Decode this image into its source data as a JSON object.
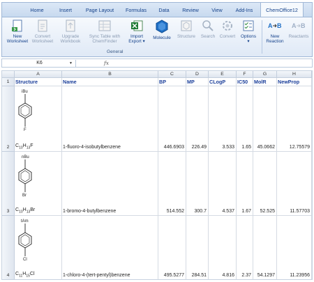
{
  "ribbon_tabs": [
    "Home",
    "Insert",
    "Page Layout",
    "Formulas",
    "Data",
    "Review",
    "View",
    "Add-Ins",
    "ChemOffice12"
  ],
  "active_tab": "ChemOffice12",
  "ribbon": {
    "new_worksheet": [
      "New",
      "Worksheet"
    ],
    "convert_worksheet": [
      "Convert",
      "Worksheet"
    ],
    "upgrade_workbook": [
      "Upgrade",
      "Workbook"
    ],
    "sync_table": [
      "Sync Table with",
      "ChemFinder"
    ],
    "import_export": [
      "Import",
      "Export ▾"
    ],
    "molecule": "Molecule",
    "structure": "Structure",
    "search": "Search",
    "convert": "Convert",
    "options": "Options",
    "new_reaction": [
      "New",
      "Reaction"
    ],
    "reactants": "Reactants",
    "group_label": "General"
  },
  "formula_bar": {
    "name_box": "K6",
    "fx": "fx",
    "formula": ""
  },
  "columns": [
    "A",
    "B",
    "C",
    "D",
    "E",
    "F",
    "G",
    "H"
  ],
  "headers": [
    "Structure",
    "Name",
    "BP",
    "MP",
    "CLogP",
    "IC50",
    "MolR",
    "NewProp"
  ],
  "rows": [
    {
      "row_num": "2",
      "substituent": "iBu",
      "halogen": "F",
      "formula": {
        "c": "C",
        "c_n": "10",
        "h": "H",
        "h_n": "13",
        "x": "F"
      },
      "name": "1-fluoro-4-isobutylbenzene",
      "bp": "446.6903",
      "mp": "226.49",
      "clogp": "3.533",
      "ic50": "1.65",
      "molr": "45.0662",
      "newprop": "12.75579"
    },
    {
      "row_num": "3",
      "substituent": "nBu",
      "halogen": "Br",
      "formula": {
        "c": "C",
        "c_n": "10",
        "h": "H",
        "h_n": "13",
        "x": "Br"
      },
      "name": "1-bromo-4-butylbenzene",
      "bp": "514.552",
      "mp": "300.7",
      "clogp": "4.537",
      "ic50": "1.67",
      "molr": "52.525",
      "newprop": "11.57703"
    },
    {
      "row_num": "4",
      "substituent": "tAm",
      "halogen": "Cl",
      "formula": {
        "c": "C",
        "c_n": "11",
        "h": "H",
        "h_n": "15",
        "x": "Cl"
      },
      "name": "1-chloro-4-(tert-pentyl)benzene",
      "bp": "495.5277",
      "mp": "284.51",
      "clogp": "4.816",
      "ic50": "2.37",
      "molr": "54.1297",
      "newprop": "11.23956"
    }
  ],
  "colors": {
    "accent": "#15428b",
    "header_text": "#1a3e9a",
    "excel_green": "#1e7b34",
    "molecule_blue": "#1f6fc5"
  }
}
